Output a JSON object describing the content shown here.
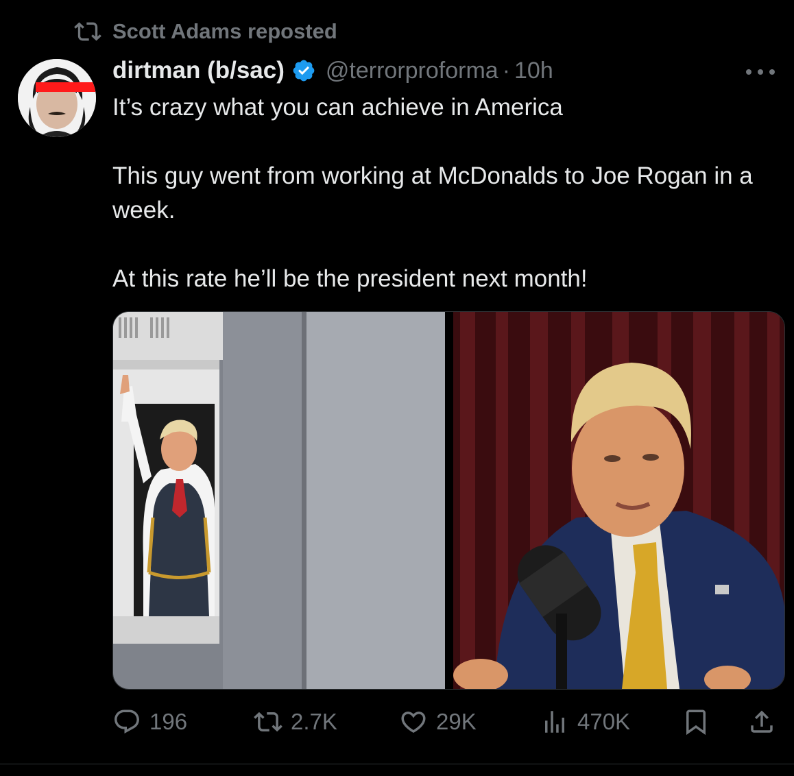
{
  "repost": {
    "text": "Scott Adams reposted",
    "icon": "repost-icon"
  },
  "author": {
    "display_name": "dirtman (b/sac)",
    "handle": "@terrorproforma",
    "separator": "·",
    "time": "10h",
    "verified_icon": "verified-badge-icon"
  },
  "tweet": {
    "lines": [
      "It’s crazy what you can achieve in America",
      "This guy went from working at McDonalds to Joe Rogan in a week.",
      "At this rate he’ll be the president next month!"
    ]
  },
  "media": {
    "photo_left": {
      "icon": "photo-drive-thru-window"
    },
    "photo_right": {
      "icon": "photo-podcast-microphone"
    }
  },
  "actions": {
    "replies": "196",
    "reposts": "2.7K",
    "likes": "29K",
    "views": "470K"
  },
  "colors": {
    "background": "#000000",
    "text_primary": "#e7e9ea",
    "text_secondary": "#71767b",
    "verified_blue": "#1d9bf0",
    "divider": "#2f3336"
  }
}
